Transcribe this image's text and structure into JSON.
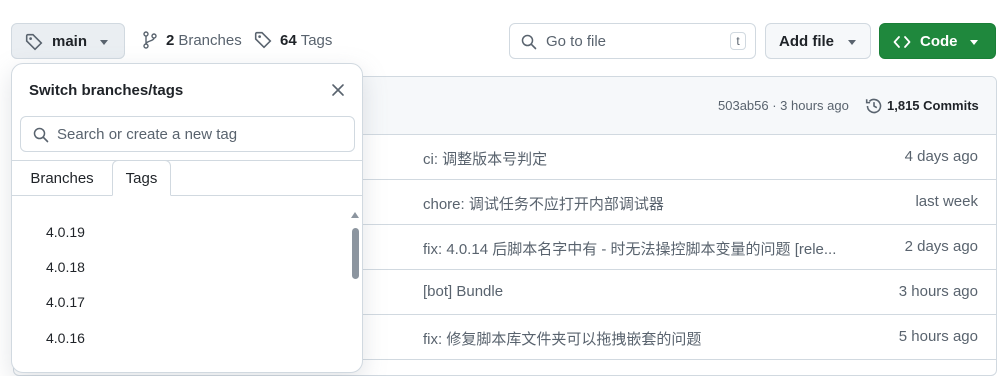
{
  "branch_button": {
    "label": "main"
  },
  "stats": {
    "branches_count": "2",
    "branches_label": "Branches",
    "tags_count": "64",
    "tags_label": "Tags"
  },
  "goto_file": {
    "placeholder": "Go to file",
    "shortcut": "t"
  },
  "add_file": {
    "label": "Add file"
  },
  "code_button": {
    "label": "Code",
    "color": "#1f883d"
  },
  "latest_commit": {
    "hash_time": "503ab56 · 3 hours ago",
    "commits": "1,815 Commits"
  },
  "rows": [
    {
      "message": "ci: 调整版本号判定",
      "time": "4 days ago"
    },
    {
      "message": "chore: 调试任务不应打开内部调试器",
      "time": "last week"
    },
    {
      "message": "fix: 4.0.14 后脚本名字中有 - 时无法操控脚本变量的问题 [rele...",
      "time": "2 days ago"
    },
    {
      "message": "[bot] Bundle",
      "time": "3 hours ago"
    },
    {
      "message": "fix: 修复脚本库文件夹可以拖拽嵌套的问题",
      "time": "5 hours ago"
    }
  ],
  "dropdown": {
    "title": "Switch branches/tags",
    "search_placeholder": "Search or create a new tag",
    "tabs": [
      "Branches",
      "Tags"
    ],
    "active_tab": "Tags",
    "tags": [
      "4.0.19",
      "4.0.18",
      "4.0.17",
      "4.0.16"
    ]
  },
  "icons": {
    "tag": "tag-icon",
    "branch": "git-branch-icon",
    "search": "search-icon",
    "history": "history-icon",
    "code": "code-icon",
    "close": "close-icon"
  }
}
